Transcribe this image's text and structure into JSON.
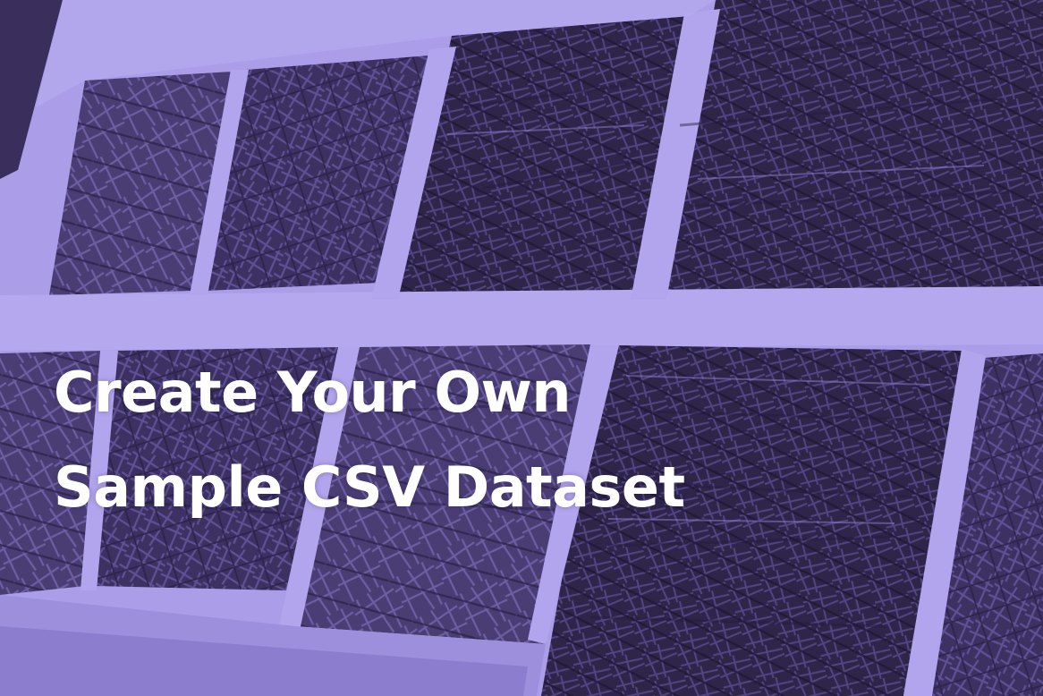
{
  "image": {
    "subject": "sketched window panes",
    "tint_color": "#a99be6",
    "pane_color": "#3a2f5c",
    "frame_color": "#b7aaef"
  },
  "overlay": {
    "line1": "Create Your Own",
    "line2": "Sample CSV Dataset",
    "text_color": "#ffffff"
  }
}
